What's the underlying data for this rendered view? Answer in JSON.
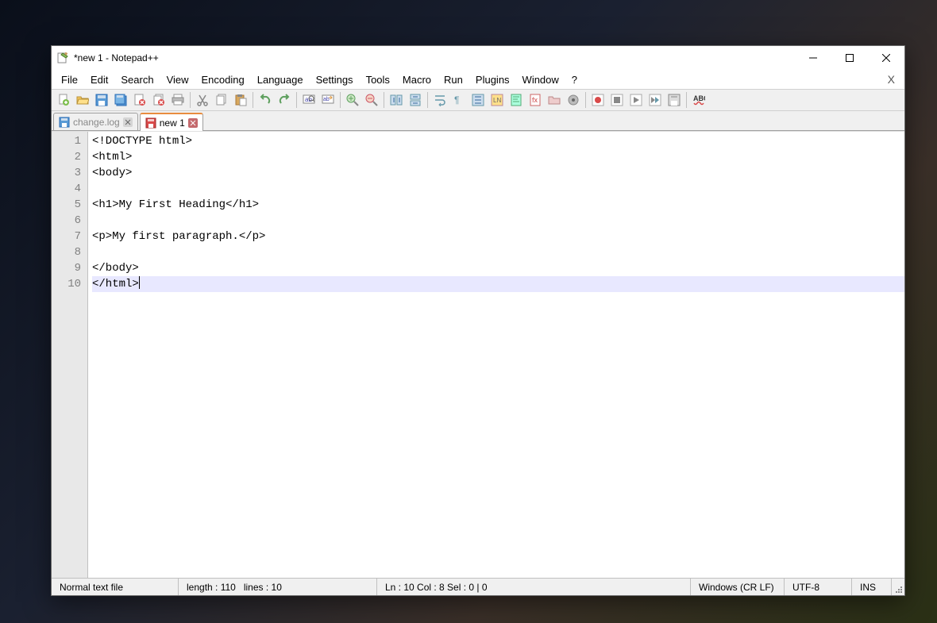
{
  "title": "*new 1 - Notepad++",
  "menus": [
    "File",
    "Edit",
    "Search",
    "View",
    "Encoding",
    "Language",
    "Settings",
    "Tools",
    "Macro",
    "Run",
    "Plugins",
    "Window",
    "?"
  ],
  "toolbar_icons": [
    "new-file-icon",
    "open-file-icon",
    "save-icon",
    "save-all-icon",
    "close-icon-btn",
    "close-all-icon",
    "print-icon",
    "sep",
    "cut-icon",
    "copy-icon",
    "paste-icon",
    "sep",
    "undo-icon",
    "redo-icon",
    "sep",
    "find-icon",
    "replace-icon",
    "sep",
    "zoom-in-icon",
    "zoom-out-icon",
    "sep",
    "sync-v-icon",
    "sync-h-icon",
    "sep",
    "wrap-icon",
    "show-all-icon",
    "indent-guide-icon",
    "udl-icon",
    "doc-map-icon",
    "func-list-icon",
    "folder-icon",
    "monitor-icon",
    "sep",
    "record-icon",
    "stop-icon",
    "play-icon",
    "play-multi-icon",
    "save-macro-icon",
    "sep",
    "spellcheck-icon"
  ],
  "tabs": [
    {
      "label": "change.log",
      "active": false,
      "save_icon": "saved"
    },
    {
      "label": "new 1",
      "active": true,
      "save_icon": "modified"
    }
  ],
  "code_lines": [
    "<!DOCTYPE html>",
    "<html>",
    "<body>",
    "",
    "<h1>My First Heading</h1>",
    "",
    "<p>My first paragraph.</p>",
    "",
    "</body>",
    "</html>"
  ],
  "current_line_index": 9,
  "status": {
    "filetype": "Normal text file",
    "length_label": "length : 110",
    "lines_label": "lines : 10",
    "position": "Ln : 10   Col : 8   Sel : 0 | 0",
    "eol": "Windows (CR LF)",
    "encoding": "UTF-8",
    "insert": "INS"
  }
}
